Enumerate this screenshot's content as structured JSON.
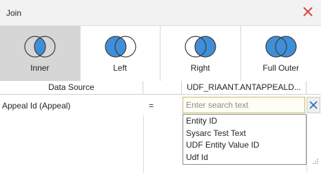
{
  "dialog": {
    "title": "Join",
    "close_color": "#d64541"
  },
  "join_types": [
    {
      "label": "Inner",
      "selected": true,
      "icon": "inner-join-icon"
    },
    {
      "label": "Left",
      "selected": false,
      "icon": "left-join-icon"
    },
    {
      "label": "Right",
      "selected": false,
      "icon": "right-join-icon"
    },
    {
      "label": "Full Outer",
      "selected": false,
      "icon": "full-outer-join-icon"
    }
  ],
  "columns": {
    "left": "Data Source",
    "right": "UDF_RIAANT.ANTAPPEALD..."
  },
  "clause": {
    "left_field": "Appeal Id (Appeal)",
    "operator": "=",
    "search_value": "",
    "search_placeholder": "Enter search text"
  },
  "dropdown": {
    "options": [
      "Entity ID",
      "Sysarc Test Text",
      "UDF Entity Value ID",
      "Udf Id"
    ]
  },
  "colors": {
    "venn_fill": "#3f8fd8",
    "venn_stroke": "#3a3a3a",
    "selected_bg": "#d6d6d6"
  }
}
